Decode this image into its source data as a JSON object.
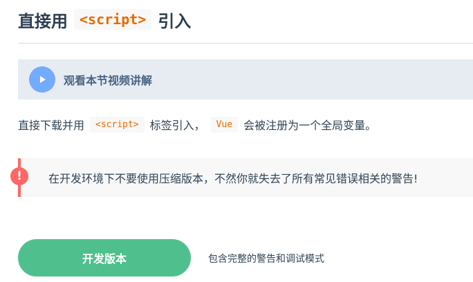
{
  "heading": {
    "before": "直接用",
    "code": "<script>",
    "after": "引入"
  },
  "video": {
    "label": "观看本节视频讲解",
    "icon": "play-icon"
  },
  "intro": {
    "part1": "直接下载并用",
    "code1": "<script>",
    "part2": "标签引入，",
    "code2": "Vue",
    "part3": "会被注册为一个全局变量。"
  },
  "warning": {
    "icon_text": "!",
    "text": "在开发环境下不要使用压缩版本，不然你就失去了所有常见错误相关的警告!"
  },
  "download": {
    "button_label": "开发版本",
    "description": "包含完整的警告和调试模式"
  },
  "colors": {
    "accent_green": "#4fc08d",
    "warning_red": "#ff6666",
    "code_orange": "#e96900",
    "video_bg": "#e7ecf3",
    "play_blue": "#73abfe"
  }
}
